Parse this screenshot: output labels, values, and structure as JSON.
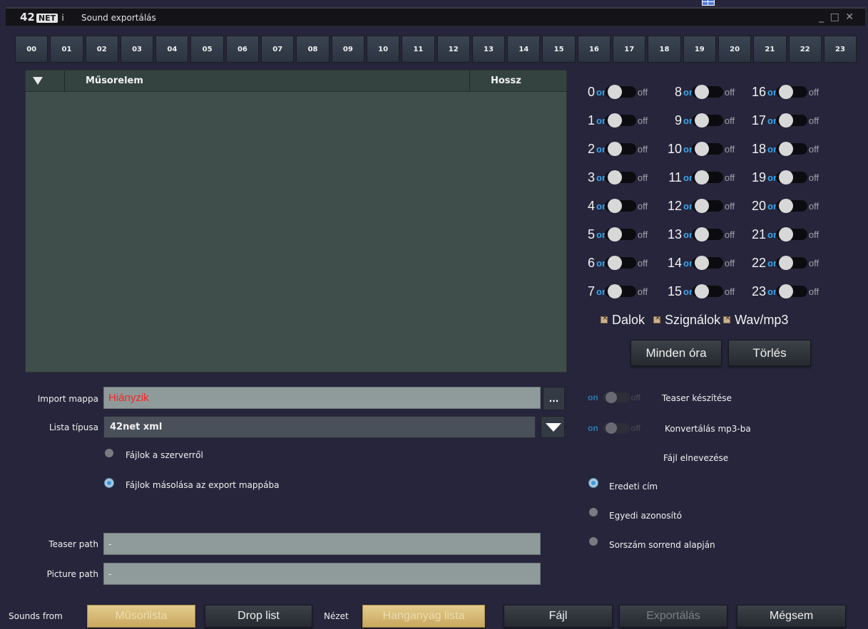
{
  "window": {
    "logo_text": "42",
    "logo_badge": "NET",
    "logo_suffix": "i",
    "title": "Sound exportálás",
    "controls": "_ □ ✕"
  },
  "hours": [
    "00",
    "01",
    "02",
    "03",
    "04",
    "05",
    "06",
    "07",
    "08",
    "09",
    "10",
    "11",
    "12",
    "13",
    "14",
    "15",
    "16",
    "17",
    "18",
    "19",
    "20",
    "21",
    "22",
    "23"
  ],
  "list": {
    "col_title": "Műsorelem",
    "col_length": "Hossz"
  },
  "hour_toggles": {
    "on_label": "on",
    "off_label": "off",
    "rows": [
      [
        "0",
        "8",
        "16"
      ],
      [
        "1",
        "9",
        "17"
      ],
      [
        "2",
        "10",
        "18"
      ],
      [
        "3",
        "11",
        "19"
      ],
      [
        "4",
        "12",
        "20"
      ],
      [
        "5",
        "13",
        "21"
      ],
      [
        "6",
        "14",
        "22"
      ],
      [
        "7",
        "15",
        "23"
      ]
    ]
  },
  "checkboxes": [
    "Dalok",
    "Szignálok",
    "Wav/mp3"
  ],
  "buttons": {
    "all_hours": "Minden óra",
    "delete": "Törlés"
  },
  "import": {
    "label": "Import mappa",
    "value": "Hiányzik",
    "browse": "..."
  },
  "list_type": {
    "label": "Lista típusa",
    "value": "42net xml"
  },
  "source_options": [
    "Fájlok a szerverről",
    "Fájlok másolása az export mappába"
  ],
  "teaser_path": {
    "label": "Teaser path",
    "value": "-"
  },
  "picture_path": {
    "label": "Picture path",
    "value": "-"
  },
  "options": {
    "teaser_label": "Teaser készítése",
    "convert_label": "Konvertálás mp3-ba",
    "on": "on",
    "off": "off",
    "naming_title": "Fájl elnevezése",
    "naming": [
      "Eredeti cím",
      "Egyedi azonosító",
      "Sorszám sorrend alapján"
    ]
  },
  "bottom": {
    "sounds_from": "Sounds from",
    "musorlista": "Műsorlista",
    "drop_list": "Drop list",
    "view_label": "Nézet",
    "hanganyag": "Hanganyag lista",
    "file": "Fájl",
    "export": "Exportálás",
    "cancel": "Mégsem"
  },
  "colors": {
    "background": "#26253b",
    "accent_blue": "#36a8f0",
    "gold": "#d4b774",
    "missing_red": "#ff1f1f"
  }
}
